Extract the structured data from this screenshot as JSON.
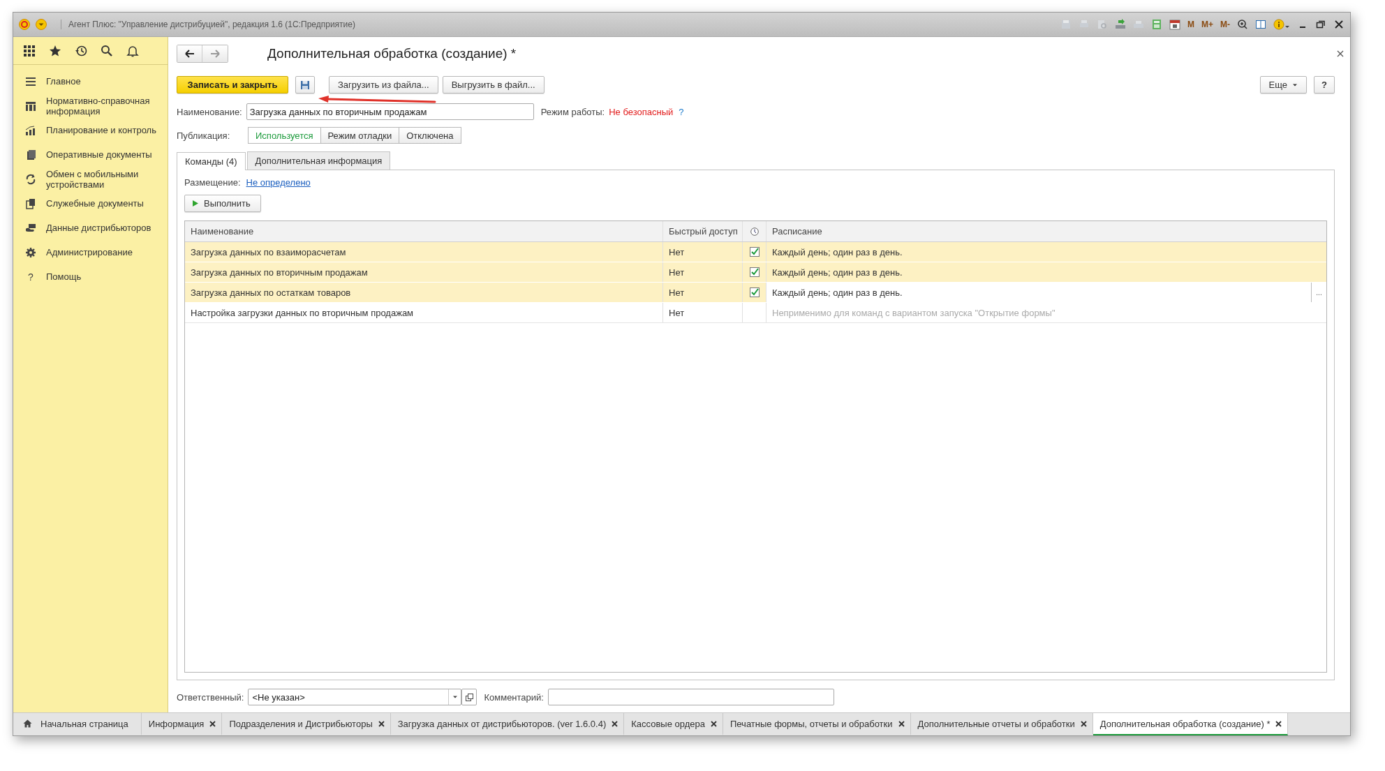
{
  "window": {
    "title": "Агент Плюс: \"Управление дистрибуцией\", редакция 1.6  (1С:Предприятие)",
    "memory_buttons": [
      "M",
      "M+",
      "M-"
    ]
  },
  "sidebar": {
    "items": [
      {
        "label": "Главное"
      },
      {
        "label": "Нормативно-справочная информация"
      },
      {
        "label": "Планирование и контроль"
      },
      {
        "label": "Оперативные документы"
      },
      {
        "label": "Обмен с мобильными устройствами"
      },
      {
        "label": "Служебные документы"
      },
      {
        "label": "Данные дистрибьюторов"
      },
      {
        "label": "Администрирование"
      },
      {
        "label": "Помощь",
        "icon_char": "?"
      }
    ]
  },
  "form": {
    "title": "Дополнительная обработка (создание) *",
    "buttons": {
      "save_close": "Записать и закрыть",
      "load": "Загрузить из файла...",
      "unload": "Выгрузить в файл...",
      "more": "Еще",
      "help": "?"
    },
    "name": {
      "label": "Наименование:",
      "value": "Загрузка данных по вторичным продажам"
    },
    "mode": {
      "label": "Режим работы:",
      "value": "Не безопасный",
      "help": "?"
    },
    "publication": {
      "label": "Публикация:",
      "options": [
        {
          "label": "Используется",
          "selected": true
        },
        {
          "label": "Режим отладки",
          "selected": false
        },
        {
          "label": "Отключена",
          "selected": false
        }
      ]
    },
    "tabs": [
      {
        "label": "Команды (4)",
        "selected": true
      },
      {
        "label": "Дополнительная информация",
        "selected": false
      }
    ],
    "placement": {
      "label": "Размещение:",
      "link": "Не определено"
    },
    "run_button": "Выполнить",
    "table": {
      "columns": [
        "Наименование",
        "Быстрый доступ",
        "Расписание"
      ],
      "rows": [
        {
          "name": "Загрузка данных по взаиморасчетам",
          "quick_access": "Нет",
          "kind": "scheduled",
          "checked": true,
          "schedule": "Каждый день; один раз в день.",
          "selected": true
        },
        {
          "name": "Загрузка данных по вторичным продажам",
          "quick_access": "Нет",
          "kind": "scheduled",
          "checked": true,
          "schedule": "Каждый день; один раз в день.",
          "selected": true
        },
        {
          "name": "Загрузка данных по остаткам товаров",
          "quick_access": "Нет",
          "kind": "scheduled",
          "checked": true,
          "schedule": "Каждый день; один раз в день.",
          "selected": true,
          "choice_button": "..."
        },
        {
          "name": "Настройка загрузки данных по вторичным продажам",
          "quick_access": "Нет",
          "kind": "manual",
          "schedule": "Неприменимо для команд с вариантом запуска \"Открытие формы\"",
          "selected": false
        }
      ]
    },
    "responsible": {
      "label": "Ответственный:",
      "value": "<Не указан>"
    },
    "comment": {
      "label": "Комментарий:"
    }
  },
  "open_windows": [
    {
      "label": "Начальная страница",
      "kind": "home",
      "selected": false
    },
    {
      "label": "Информация",
      "kind": "doc",
      "selected": false
    },
    {
      "label": "Подразделения и Дистрибьюторы",
      "kind": "doc",
      "selected": false
    },
    {
      "label": "Загрузка данных от дистрибьюторов. (ver 1.6.0.4)",
      "kind": "doc",
      "selected": false
    },
    {
      "label": "Кассовые ордера",
      "kind": "doc",
      "selected": false
    },
    {
      "label": "Печатные формы, отчеты и обработки",
      "kind": "doc",
      "selected": false
    },
    {
      "label": "Дополнительные отчеты и обработки",
      "kind": "doc",
      "selected": false
    },
    {
      "label": "Дополнительная обработка (создание) *",
      "kind": "doc",
      "selected": true
    }
  ]
}
